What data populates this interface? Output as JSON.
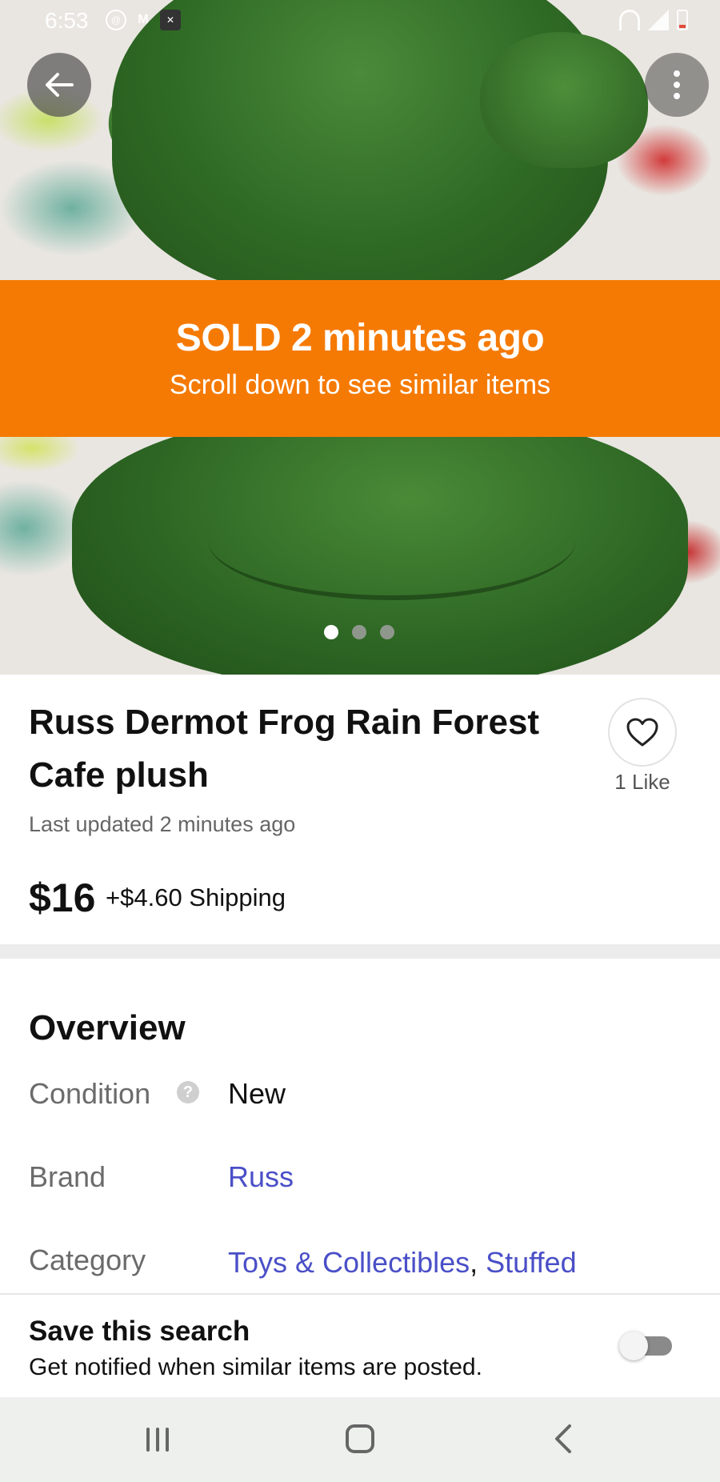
{
  "status_bar": {
    "time": "6:53",
    "left_icons": [
      "at-sign-icon",
      "gmail-icon",
      "x-icon"
    ],
    "right_icons": [
      "wifi-icon",
      "signal-icon",
      "battery-icon"
    ]
  },
  "photo": {
    "description_icon": "product-photo",
    "carousel": {
      "total": 3,
      "active_index": 0
    }
  },
  "sold_banner": {
    "title": "SOLD 2 minutes ago",
    "subtitle": "Scroll down to see similar items",
    "color": "#f57a04"
  },
  "listing": {
    "title": "Russ Dermot Frog Rain Forest Cafe plush",
    "likes": "1 Like",
    "updated": "Last updated 2 minutes ago",
    "price": "$16",
    "shipping": "+$4.60 Shipping"
  },
  "overview": {
    "title": "Overview",
    "condition_label": "Condition",
    "condition_value": "New",
    "help_glyph": "?",
    "brand_label": "Brand",
    "brand_value": "Russ",
    "category_label": "Category",
    "category_link_1": "Toys & Collectibles",
    "category_separator": ",",
    "category_link_2": "Stuffed",
    "link_color": "#4a4fc7"
  },
  "save_search": {
    "title": "Save this search",
    "subtitle": "Get notified when similar items are posted.",
    "toggle_on": false
  }
}
